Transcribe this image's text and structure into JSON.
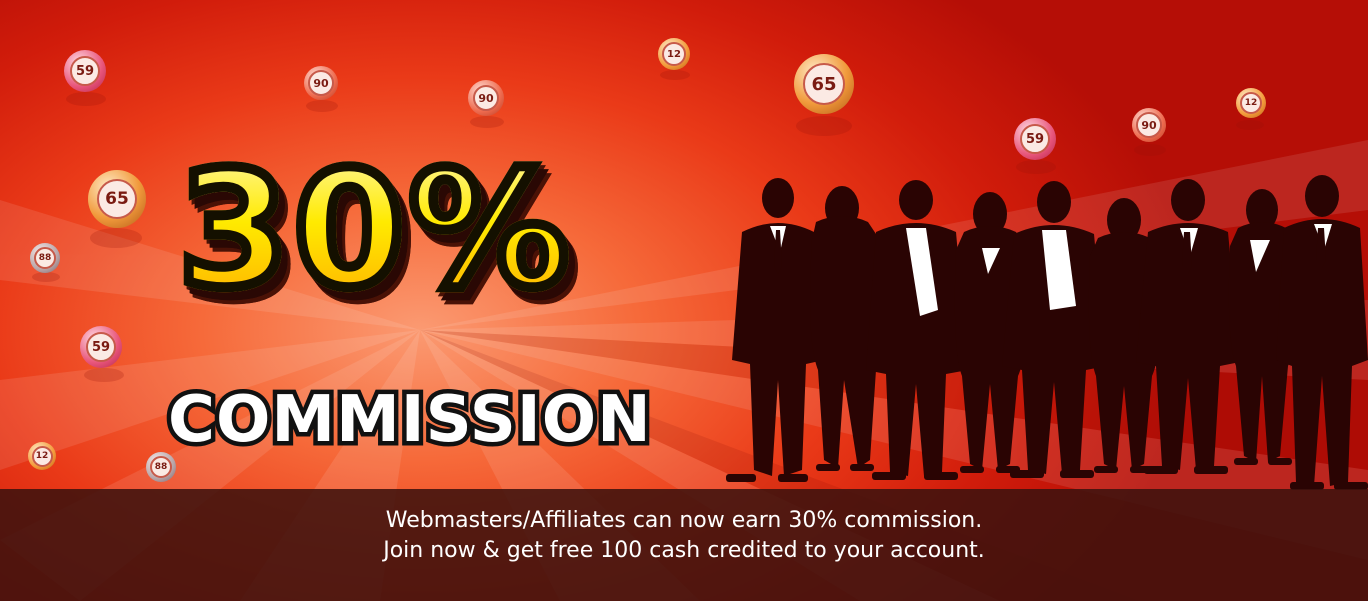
{
  "promo": {
    "headline": "30%",
    "subheadline": "COMMISSION",
    "footer_line_1": "Webmasters/Affiliates can now earn 30% commission.",
    "footer_line_2": "Join now & get free 100 cash credited to your account."
  },
  "bingo_balls": [
    "59",
    "90",
    "90",
    "12",
    "65",
    "59",
    "90",
    "12",
    "65",
    "88",
    "59",
    "12",
    "88"
  ],
  "colors": {
    "headline_fill": "#ffe000",
    "headline_outline": "#141000",
    "subheadline_fill": "#ffffff",
    "background_red": "#d11c0b",
    "footer_bar": "#3e120e",
    "silhouette": "#2a0403"
  },
  "icons": [
    "bingo-ball-icon",
    "business-people-silhouette-icon"
  ]
}
